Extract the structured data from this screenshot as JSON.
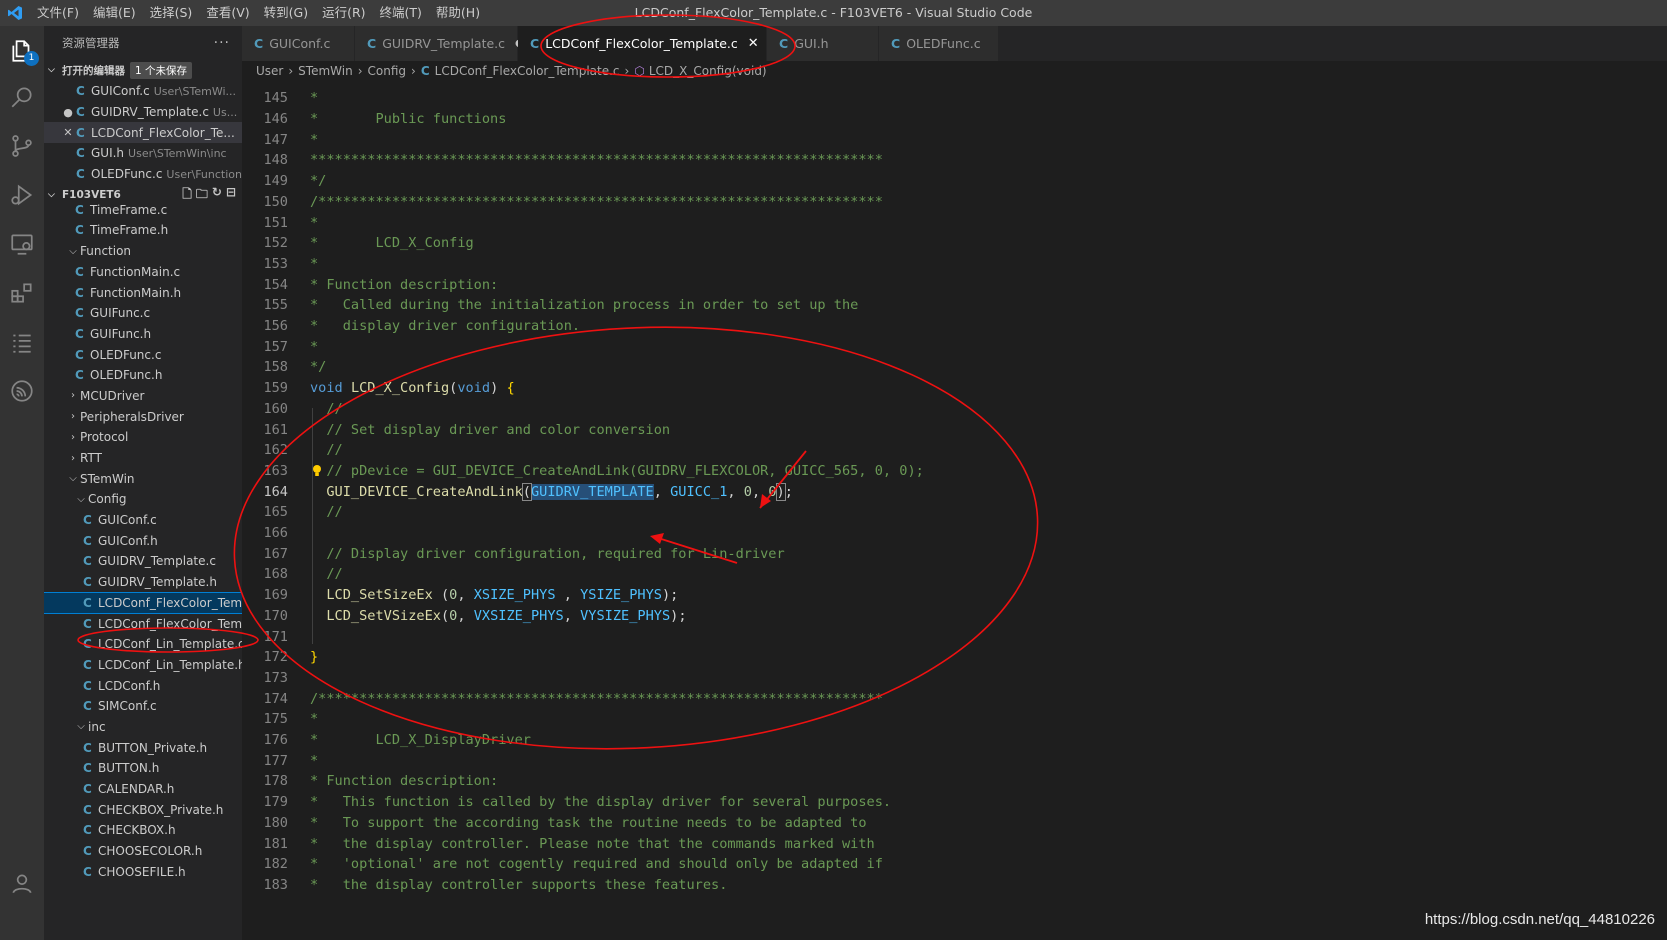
{
  "titlebar": {
    "menu": [
      "文件(F)",
      "编辑(E)",
      "选择(S)",
      "查看(V)",
      "转到(G)",
      "运行(R)",
      "终端(T)",
      "帮助(H)"
    ],
    "title": "LCDConf_FlexColor_Template.c - F103VET6 - Visual Studio Code"
  },
  "activity": {
    "explorer_badge": "1"
  },
  "sidebar": {
    "header": "资源管理器",
    "more": "···",
    "open_editors": {
      "title": "打开的编辑器",
      "unsaved": "1 个未保存",
      "items": [
        {
          "icon": "C",
          "name": "GUIConf.c",
          "path": "User\\STemWi...",
          "mark": ""
        },
        {
          "icon": "C",
          "name": "GUIDRV_Template.c",
          "path": "Us...",
          "mark": "●"
        },
        {
          "icon": "C",
          "name": "LCDConf_FlexColor_Te...",
          "path": "",
          "mark": "✕"
        },
        {
          "icon": "C",
          "name": "GUI.h",
          "path": "User\\STemWin\\inc",
          "mark": ""
        },
        {
          "icon": "C",
          "name": "OLEDFunc.c",
          "path": "User\\Function",
          "mark": ""
        }
      ]
    },
    "project": {
      "title": "F103VET6",
      "tree": [
        {
          "type": "file",
          "icon": "C",
          "name": "TimeFrame.c",
          "indent": 1
        },
        {
          "type": "file",
          "icon": "C",
          "name": "TimeFrame.h",
          "indent": 1
        },
        {
          "type": "folder",
          "open": true,
          "name": "Function",
          "indent": 0
        },
        {
          "type": "file",
          "icon": "C",
          "name": "FunctionMain.c",
          "indent": 1
        },
        {
          "type": "file",
          "icon": "C",
          "name": "FunctionMain.h",
          "indent": 1
        },
        {
          "type": "file",
          "icon": "C",
          "name": "GUIFunc.c",
          "indent": 1
        },
        {
          "type": "file",
          "icon": "C",
          "name": "GUIFunc.h",
          "indent": 1
        },
        {
          "type": "file",
          "icon": "C",
          "name": "OLEDFunc.c",
          "indent": 1
        },
        {
          "type": "file",
          "icon": "C",
          "name": "OLEDFunc.h",
          "indent": 1
        },
        {
          "type": "folder",
          "open": false,
          "name": "MCUDriver",
          "indent": 0
        },
        {
          "type": "folder",
          "open": false,
          "name": "PeripheralsDriver",
          "indent": 0
        },
        {
          "type": "folder",
          "open": false,
          "name": "Protocol",
          "indent": 0
        },
        {
          "type": "folder",
          "open": false,
          "name": "RTT",
          "indent": 0
        },
        {
          "type": "folder",
          "open": true,
          "name": "STemWin",
          "indent": 0
        },
        {
          "type": "folder",
          "open": true,
          "name": "Config",
          "indent": 1
        },
        {
          "type": "file",
          "icon": "C",
          "name": "GUIConf.c",
          "indent": 2
        },
        {
          "type": "file",
          "icon": "C",
          "name": "GUIConf.h",
          "indent": 2
        },
        {
          "type": "file",
          "icon": "C",
          "name": "GUIDRV_Template.c",
          "indent": 2
        },
        {
          "type": "file",
          "icon": "C",
          "name": "GUIDRV_Template.h",
          "indent": 2
        },
        {
          "type": "file",
          "icon": "C",
          "name": "LCDConf_FlexColor_Tem...",
          "indent": 2,
          "selected": true
        },
        {
          "type": "file",
          "icon": "C",
          "name": "LCDConf_FlexColor_Tem...",
          "indent": 2
        },
        {
          "type": "file",
          "icon": "C",
          "name": "LCDConf_Lin_Template.c",
          "indent": 2
        },
        {
          "type": "file",
          "icon": "C",
          "name": "LCDConf_Lin_Template.h",
          "indent": 2
        },
        {
          "type": "file",
          "icon": "C",
          "name": "LCDConf.h",
          "indent": 2
        },
        {
          "type": "file",
          "icon": "C",
          "name": "SIMConf.c",
          "indent": 2
        },
        {
          "type": "folder",
          "open": true,
          "name": "inc",
          "indent": 1
        },
        {
          "type": "file",
          "icon": "C",
          "name": "BUTTON_Private.h",
          "indent": 2
        },
        {
          "type": "file",
          "icon": "C",
          "name": "BUTTON.h",
          "indent": 2
        },
        {
          "type": "file",
          "icon": "C",
          "name": "CALENDAR.h",
          "indent": 2
        },
        {
          "type": "file",
          "icon": "C",
          "name": "CHECKBOX_Private.h",
          "indent": 2
        },
        {
          "type": "file",
          "icon": "C",
          "name": "CHECKBOX.h",
          "indent": 2
        },
        {
          "type": "file",
          "icon": "C",
          "name": "CHOOSECOLOR.h",
          "indent": 2
        },
        {
          "type": "file",
          "icon": "C",
          "name": "CHOOSEFILE.h",
          "indent": 2
        }
      ]
    }
  },
  "tabs": [
    {
      "icon": "C",
      "label": "GUIConf.c",
      "state": ""
    },
    {
      "icon": "C",
      "label": "GUIDRV_Template.c",
      "state": "●"
    },
    {
      "icon": "C",
      "label": "LCDConf_FlexColor_Template.c",
      "state": "✕",
      "active": true
    },
    {
      "icon": "C",
      "label": "GUI.h",
      "state": ""
    },
    {
      "icon": "C",
      "label": "OLEDFunc.c",
      "state": ""
    }
  ],
  "breadcrumb": {
    "parts": [
      "User",
      "STemWin",
      "Config"
    ],
    "file_icon": "C",
    "file": "LCDConf_FlexColor_Template.c",
    "symbol": "LCD_X_Config(void)"
  },
  "editor": {
    "current_line": 164,
    "lines": [
      {
        "n": 145,
        "t": [
          [
            "cmt",
            "*"
          ]
        ]
      },
      {
        "n": 146,
        "t": [
          [
            "cmt",
            "*       Public functions"
          ]
        ]
      },
      {
        "n": 147,
        "t": [
          [
            "cmt",
            "*"
          ]
        ]
      },
      {
        "n": 148,
        "t": [
          [
            "cmt",
            "**********************************************************************"
          ]
        ]
      },
      {
        "n": 149,
        "t": [
          [
            "cmt",
            "*/"
          ]
        ]
      },
      {
        "n": 150,
        "t": [
          [
            "cmt",
            "/*********************************************************************"
          ]
        ]
      },
      {
        "n": 151,
        "t": [
          [
            "cmt",
            "*"
          ]
        ]
      },
      {
        "n": 152,
        "t": [
          [
            "cmt",
            "*       LCD_X_Config"
          ]
        ]
      },
      {
        "n": 153,
        "t": [
          [
            "cmt",
            "*"
          ]
        ]
      },
      {
        "n": 154,
        "t": [
          [
            "cmt",
            "* Function description:"
          ]
        ]
      },
      {
        "n": 155,
        "t": [
          [
            "cmt",
            "*   Called during the initialization process in order to set up the"
          ]
        ]
      },
      {
        "n": 156,
        "t": [
          [
            "cmt",
            "*   display driver configuration."
          ]
        ]
      },
      {
        "n": 157,
        "t": [
          [
            "cmt",
            "*"
          ]
        ]
      },
      {
        "n": 158,
        "t": [
          [
            "cmt",
            "*/"
          ]
        ]
      },
      {
        "n": 159,
        "t": [
          [
            "kw",
            "void"
          ],
          [
            "punc",
            " "
          ],
          [
            "fn",
            "LCD_X_Config"
          ],
          [
            "punc",
            "("
          ],
          [
            "kw",
            "void"
          ],
          [
            "punc",
            ") "
          ],
          [
            "brace",
            "{"
          ]
        ]
      },
      {
        "n": 160,
        "t": [
          [
            "cmt",
            "  //"
          ]
        ]
      },
      {
        "n": 161,
        "t": [
          [
            "cmt",
            "  // Set display driver and color conversion"
          ]
        ]
      },
      {
        "n": 162,
        "t": [
          [
            "cmt",
            "  //"
          ]
        ]
      },
      {
        "n": 163,
        "t": [
          [
            "cmt",
            "  // pDevice = GUI_DEVICE_CreateAndLink(GUIDRV_FLEXCOLOR, GUICC_565, 0, 0);"
          ]
        ]
      },
      {
        "n": 164,
        "t": [
          [
            "fn",
            "  GUI_DEVICE_CreateAndLink"
          ],
          [
            "box",
            "("
          ],
          [
            "machl",
            "GUIDRV_TEMPLATE"
          ],
          [
            "punc",
            ", "
          ],
          [
            "mac",
            "GUICC_1"
          ],
          [
            "punc",
            ", "
          ],
          [
            "num",
            "0"
          ],
          [
            "punc",
            ", "
          ],
          [
            "num",
            "0"
          ],
          [
            "box",
            ")"
          ],
          [
            "punc",
            ";"
          ]
        ]
      },
      {
        "n": 165,
        "t": [
          [
            "cmt",
            "  //"
          ]
        ]
      },
      {
        "n": 166,
        "t": []
      },
      {
        "n": 167,
        "t": [
          [
            "cmt",
            "  // Display driver configuration, required for Lin-driver"
          ]
        ]
      },
      {
        "n": 168,
        "t": [
          [
            "cmt",
            "  //"
          ]
        ]
      },
      {
        "n": 169,
        "t": [
          [
            "fn",
            "  LCD_SetSizeEx"
          ],
          [
            "punc",
            " ("
          ],
          [
            "num",
            "0"
          ],
          [
            "punc",
            ", "
          ],
          [
            "mac",
            "XSIZE_PHYS"
          ],
          [
            "punc",
            " , "
          ],
          [
            "mac",
            "YSIZE_PHYS"
          ],
          [
            "punc",
            ");"
          ]
        ]
      },
      {
        "n": 170,
        "t": [
          [
            "fn",
            "  LCD_SetVSizeEx"
          ],
          [
            "punc",
            "("
          ],
          [
            "num",
            "0"
          ],
          [
            "punc",
            ", "
          ],
          [
            "mac",
            "VXSIZE_PHYS"
          ],
          [
            "punc",
            ", "
          ],
          [
            "mac",
            "VYSIZE_PHYS"
          ],
          [
            "punc",
            ");"
          ]
        ]
      },
      {
        "n": 171,
        "t": []
      },
      {
        "n": 172,
        "t": [
          [
            "brace",
            "}"
          ]
        ]
      },
      {
        "n": 173,
        "t": []
      },
      {
        "n": 174,
        "t": [
          [
            "cmt",
            "/*********************************************************************"
          ]
        ]
      },
      {
        "n": 175,
        "t": [
          [
            "cmt",
            "*"
          ]
        ]
      },
      {
        "n": 176,
        "t": [
          [
            "cmt",
            "*       LCD_X_DisplayDriver"
          ]
        ]
      },
      {
        "n": 177,
        "t": [
          [
            "cmt",
            "*"
          ]
        ]
      },
      {
        "n": 178,
        "t": [
          [
            "cmt",
            "* Function description:"
          ]
        ]
      },
      {
        "n": 179,
        "t": [
          [
            "cmt",
            "*   This function is called by the display driver for several purposes."
          ]
        ]
      },
      {
        "n": 180,
        "t": [
          [
            "cmt",
            "*   To support the according task the routine needs to be adapted to"
          ]
        ]
      },
      {
        "n": 181,
        "t": [
          [
            "cmt",
            "*   the display controller. Please note that the commands marked with"
          ]
        ]
      },
      {
        "n": 182,
        "t": [
          [
            "cmt",
            "*   'optional' are not cogently required and should only be adapted if"
          ]
        ]
      },
      {
        "n": 183,
        "t": [
          [
            "cmt",
            "*   the display controller supports these features."
          ]
        ]
      }
    ]
  },
  "watermark": "https://blog.csdn.net/qq_44810226"
}
